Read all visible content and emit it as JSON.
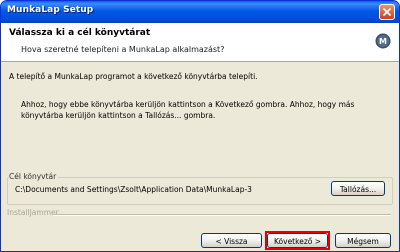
{
  "window": {
    "title": "MunkaLap Setup"
  },
  "header": {
    "title": "Válassza ki a cél könyvtárat",
    "subtitle": "Hova szeretné telepíteni a MunkaLap alkalmazást?",
    "logo_letter": "M"
  },
  "body": {
    "paragraph1": "A telepítő a MunkaLap programot a következő könyvtárba telepíti.",
    "paragraph2": "Ahhoz, hogy ebbe könyvtárba kerüljön kattintson a Következő gombra. Ahhoz, hogy más könyvtárba kerüljön kattintson a Tallózás... gombra."
  },
  "destination": {
    "label": "Cél könyvtár",
    "path": "C:\\Documents and Settings\\Zsolt\\Application Data\\MunkaLap-3",
    "browse_label": "Tallózás..."
  },
  "footer": {
    "brand": "InstallJammer",
    "back_label": "< Vissza",
    "next_label": "Következő >",
    "cancel_label": "Mégsem"
  },
  "colors": {
    "titlebar": "#0058e6",
    "dialog_bg": "#ece9d8",
    "focus_highlight": "#e80000"
  }
}
